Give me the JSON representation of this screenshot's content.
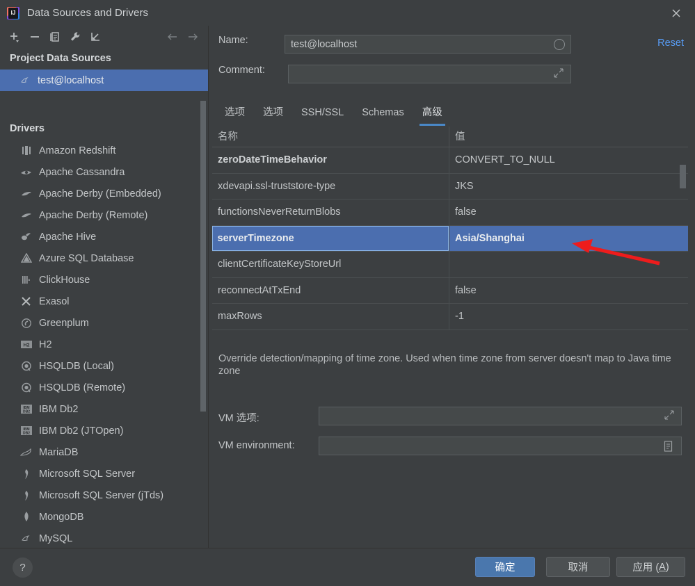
{
  "window": {
    "title": "Data Sources and Drivers",
    "logo_text": "IJ",
    "close_icon": "close-icon"
  },
  "toolbar": {
    "items": [
      {
        "name": "add-button",
        "icon": "plus-icon"
      },
      {
        "name": "remove-button",
        "icon": "minus-icon"
      },
      {
        "name": "duplicate-button",
        "icon": "copy-icon"
      },
      {
        "name": "properties-button",
        "icon": "wrench-icon"
      },
      {
        "name": "import-button",
        "icon": "import-arrow-icon"
      }
    ],
    "nav": [
      {
        "name": "back-button",
        "icon": "arrow-left-icon"
      },
      {
        "name": "forward-button",
        "icon": "arrow-right-icon"
      }
    ]
  },
  "sidebar": {
    "project_group_label": "Project Data Sources",
    "data_sources": [
      {
        "label": "test@localhost",
        "icon": "mysql-dolphin-icon",
        "selected": true
      }
    ],
    "drivers_group_label": "Drivers",
    "drivers": [
      {
        "label": "Amazon Redshift",
        "icon": "redshift-icon"
      },
      {
        "label": "Apache Cassandra",
        "icon": "cassandra-eye-icon"
      },
      {
        "label": "Apache Derby (Embedded)",
        "icon": "derby-icon"
      },
      {
        "label": "Apache Derby (Remote)",
        "icon": "derby-icon"
      },
      {
        "label": "Apache Hive",
        "icon": "hive-bee-icon"
      },
      {
        "label": "Azure SQL Database",
        "icon": "azure-icon"
      },
      {
        "label": "ClickHouse",
        "icon": "clickhouse-icon"
      },
      {
        "label": "Exasol",
        "icon": "exasol-x-icon"
      },
      {
        "label": "Greenplum",
        "icon": "greenplum-icon"
      },
      {
        "label": "H2",
        "icon": "h2-icon"
      },
      {
        "label": "HSQLDB (Local)",
        "icon": "hsqldb-icon"
      },
      {
        "label": "HSQLDB (Remote)",
        "icon": "hsqldb-icon"
      },
      {
        "label": "IBM Db2",
        "icon": "ibm-db2-icon"
      },
      {
        "label": "IBM Db2 (JTOpen)",
        "icon": "ibm-db2-icon"
      },
      {
        "label": "MariaDB",
        "icon": "mariadb-seal-icon"
      },
      {
        "label": "Microsoft SQL Server",
        "icon": "sqlserver-icon"
      },
      {
        "label": "Microsoft SQL Server (jTds)",
        "icon": "sqlserver-icon"
      },
      {
        "label": "MongoDB",
        "icon": "mongodb-leaf-icon"
      },
      {
        "label": "MySQL",
        "icon": "mysql-dolphin-icon"
      }
    ]
  },
  "details": {
    "name_label": "Name:",
    "name_value": "test@localhost",
    "name_color_indicator": "circle-icon",
    "comment_label": "Comment:",
    "comment_value": "",
    "comment_expand_icon": "expand-icon",
    "reset_label": "Reset"
  },
  "tabs": [
    {
      "label": "选项",
      "active": false
    },
    {
      "label": "选项",
      "active": false
    },
    {
      "label": "SSH/SSL",
      "active": false
    },
    {
      "label": "Schemas",
      "active": false
    },
    {
      "label": "高级",
      "active": true
    }
  ],
  "properties_table": {
    "columns": [
      "名称",
      "值"
    ],
    "rows": [
      {
        "name": "zeroDateTimeBehavior",
        "value": "CONVERT_TO_NULL",
        "bold": true,
        "selected": false
      },
      {
        "name": "xdevapi.ssl-truststore-type",
        "value": "JKS",
        "bold": false,
        "selected": false
      },
      {
        "name": "functionsNeverReturnBlobs",
        "value": "false",
        "bold": false,
        "selected": false
      },
      {
        "name": "serverTimezone",
        "value": "Asia/Shanghai",
        "bold": false,
        "selected": true
      },
      {
        "name": "clientCertificateKeyStoreUrl",
        "value": "",
        "bold": false,
        "selected": false
      },
      {
        "name": "reconnectAtTxEnd",
        "value": "false",
        "bold": false,
        "selected": false
      },
      {
        "name": "maxRows",
        "value": "-1",
        "bold": false,
        "selected": false
      }
    ]
  },
  "description": "Override detection/mapping of time zone. Used when time zone from server doesn't map to Java time zone",
  "vm": {
    "options_label": "VM 选项:",
    "options_value": "",
    "options_expand_icon": "expand-icon",
    "environment_label": "VM environment:",
    "environment_value": "",
    "environment_icon": "list-document-icon"
  },
  "footer": {
    "help_label": "?",
    "ok_label": "确定",
    "cancel_label": "取消",
    "apply_label_prefix": "应用 (",
    "apply_mnemonic": "A",
    "apply_label_suffix": ")"
  },
  "annotation": {
    "arrow_color": "#ee1c1c",
    "points_to": "Asia/Shanghai"
  },
  "colors": {
    "background": "#3c3f41",
    "selection_blue": "#4b6eaf",
    "accent_link": "#589df6",
    "tab_underline": "#4a88c7",
    "primary_button": "#4a77ad"
  }
}
